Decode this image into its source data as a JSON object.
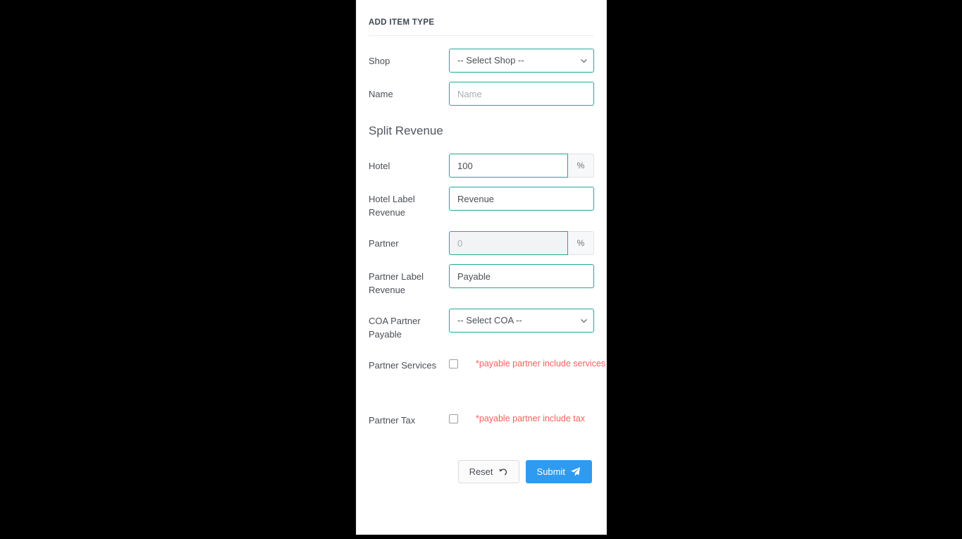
{
  "card": {
    "title": "ADD ITEM TYPE"
  },
  "form": {
    "shop": {
      "label": "Shop",
      "selected": "-- Select Shop --",
      "options": [
        "-- Select Shop --"
      ],
      "icon": "chevron-down-icon"
    },
    "name": {
      "label": "Name",
      "value": "",
      "placeholder": "Name"
    }
  },
  "split_revenue": {
    "heading": "Split Revenue",
    "hotel": {
      "label": "Hotel",
      "value": "100",
      "addon": "%"
    },
    "hotel_label_revenue": {
      "label": "Hotel Label Revenue",
      "value": "Revenue",
      "placeholder": ""
    },
    "partner": {
      "label": "Partner",
      "value": "",
      "placeholder": "0",
      "addon": "%"
    },
    "partner_label_revenue": {
      "label": "Partner Label Revenue",
      "value": "Payable",
      "placeholder": ""
    },
    "coa_partner_payable": {
      "label": "COA Partner Payable",
      "selected": "-- Select COA --",
      "options": [
        "-- Select COA --"
      ],
      "icon": "chevron-down-icon"
    },
    "partner_services": {
      "label": "Partner Services",
      "checked": false,
      "hint": "*payable partner include services"
    },
    "partner_tax": {
      "label": "Partner Tax",
      "checked": false,
      "hint": "*payable partner include tax"
    }
  },
  "footer": {
    "reset_label": "Reset",
    "reset_icon": "undo-icon",
    "submit_label": "Submit",
    "submit_icon": "paper-plane-icon"
  },
  "colors": {
    "field_border": "#21a896",
    "submit_blue": "#2f9bf0",
    "hint_red": "#f4615b",
    "label_text": "#4a4f57"
  }
}
